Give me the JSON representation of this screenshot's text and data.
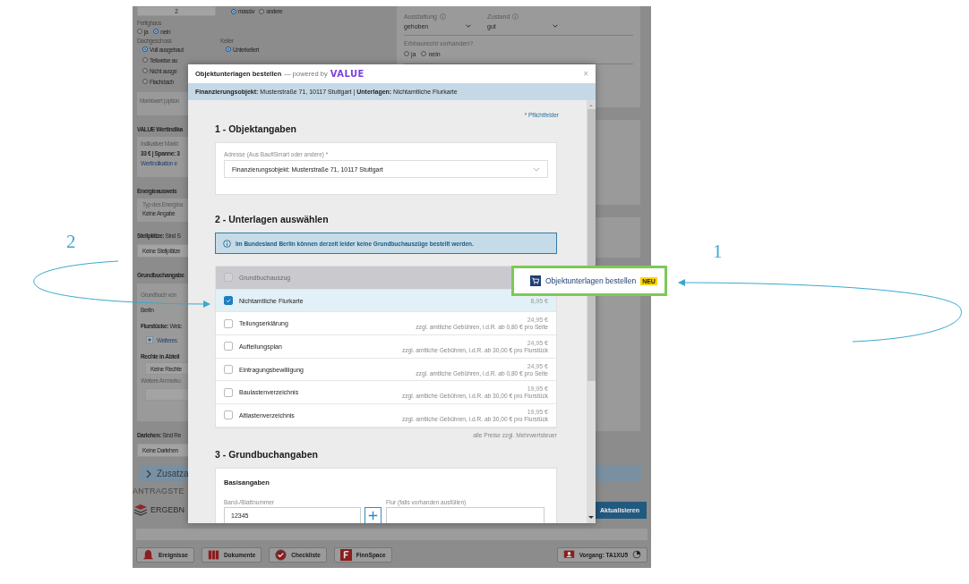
{
  "background_form": {
    "top_value": "2",
    "bauweise": [
      {
        "label": "massiv",
        "selected": true
      },
      {
        "label": "andere",
        "selected": false
      }
    ],
    "fertighaus": {
      "label": "Fertighaus",
      "options": [
        {
          "label": "ja",
          "selected": false
        },
        {
          "label": "nein",
          "selected": true
        }
      ]
    },
    "dachgeschoss": {
      "label": "Dachgeschoss",
      "options": [
        {
          "label": "Voll ausgebaut",
          "selected": true
        },
        {
          "label": "Teilweise au",
          "selected": false
        },
        {
          "label": "Nicht ausge",
          "selected": false
        },
        {
          "label": "Flachdach",
          "selected": false
        }
      ]
    },
    "keller": {
      "label": "Keller",
      "options": [
        {
          "label": "Unterkellert",
          "selected": true
        }
      ]
    },
    "marktwert_label": "Marktwert (option",
    "value_title": "VALUE Wertindika",
    "value_label": "Indikativer Markt",
    "value_text": "33 € | Spanne: 3",
    "value_link": "Wertindikation e",
    "energie_title": "Energieausweis",
    "energie_label": "Typ des Energiea",
    "energie_value": "Keine Angabe",
    "stellplaetze": "**Stellplätze:** Sind S",
    "stellplaetze_value": "Keine Stellplätze",
    "grundbuch_title": "Grundbuchangabe",
    "grundbuch_label": "Grundbuch von",
    "grundbuch_value": "Berlin",
    "flurstuecke": "**Flurstücke:** Welc",
    "weiteres": "Weiteres",
    "rechte_title": "Rechte in Abteil",
    "rechte_value": "Keine Rechte",
    "anmerkung_label": "Weitere Anmerku",
    "darlehen": "**Darlehen:** Sind Re",
    "darlehen_value": "Keine Darlehen",
    "ausstattung": {
      "label": "Ausstattung",
      "value": "gehoben"
    },
    "zustand": {
      "label": "Zustand",
      "value": "gut"
    },
    "erbbaurecht": {
      "label": "Erbbaurecht vorhanden?",
      "options": [
        {
          "label": "ja",
          "selected": false
        },
        {
          "label": "nein",
          "selected": false
        }
      ]
    },
    "zusatz": "Zusatza",
    "antrag": "ANTRAGSTE",
    "ergebnis": "ERGEBN",
    "update_button": "Aktualisieren"
  },
  "taskbar": {
    "items": [
      "Ereignisse",
      "Dokumente",
      "Checkliste",
      "FinnSpace"
    ],
    "vorgang": "Vorgang: TA1XU5"
  },
  "modal": {
    "title": "Objektunterlagen bestellen",
    "subtitle": "— powered by",
    "logo": "VALUE",
    "close": "×",
    "info": "**Finanzierungsobjekt:** Musterstraße 71, 10117 Stuttgart | **Unterlagen:** Nichtamtliche Flurkarte",
    "required_note": "* Pflichtfelder",
    "section_1": {
      "title": "1 - Objektangaben",
      "address_label": "Adresse (Aus BaufiSmart oder andere) *",
      "address_value": "Finanzierungsobjekt: Musterstraße 71, 10117 Stuttgart"
    },
    "section_2": {
      "title": "2 - Unterlagen auswählen",
      "alert": "Im Bundesland Berlin können derzeit leider keine Grundbuchauszüge bestellt werden.",
      "documents": [
        {
          "name": "Grundbuchauszug",
          "checked": false,
          "disabled": true
        },
        {
          "name": "Nichtamtliche Flurkarte",
          "checked": true,
          "disabled": false,
          "price": "8,95 €"
        },
        {
          "name": "Teilungserklärung",
          "checked": false,
          "disabled": false,
          "price": "24,95 €",
          "note": "zzgl. amtliche Gebühren, i.d.R. ab 0,80 € pro Seite"
        },
        {
          "name": "Aufteilungsplan",
          "checked": false,
          "disabled": false,
          "price": "24,95 €",
          "note": "zzgl. amtliche Gebühren, i.d.R. ab 30,00 € pro Flurstück"
        },
        {
          "name": "Eintragungsbewilligung",
          "checked": false,
          "disabled": false,
          "price": "24,95 €",
          "note": "zzgl. amtliche Gebühren, i.d.R. ab 0,80 € pro Seite"
        },
        {
          "name": "Baulastenverzeichnis",
          "checked": false,
          "disabled": false,
          "price": "19,95 €",
          "note": "zzgl. amtliche Gebühren, i.d.R. ab 30,00 € pro Flurstück"
        },
        {
          "name": "Altlastenverzeichnis",
          "checked": false,
          "disabled": false,
          "price": "19,95 €",
          "note": "zzgl. amtliche Gebühren, i.d.R. ab 30,00 € pro Flurstück"
        }
      ],
      "vat_note": "alle Preise zzgl. Mehrwertsteuer"
    },
    "section_3": {
      "title": "3 - Grundbuchangaben",
      "card_title": "Basisangaben",
      "band_label": "Band-/Blattnummer",
      "band_value": "12345",
      "flur_label": "Flur (falls vorhanden ausfüllen)"
    }
  },
  "callout": {
    "label": "Objektunterlagen bestellen",
    "badge": "NEU"
  },
  "annotation_numbers": [
    "2",
    "1"
  ]
}
